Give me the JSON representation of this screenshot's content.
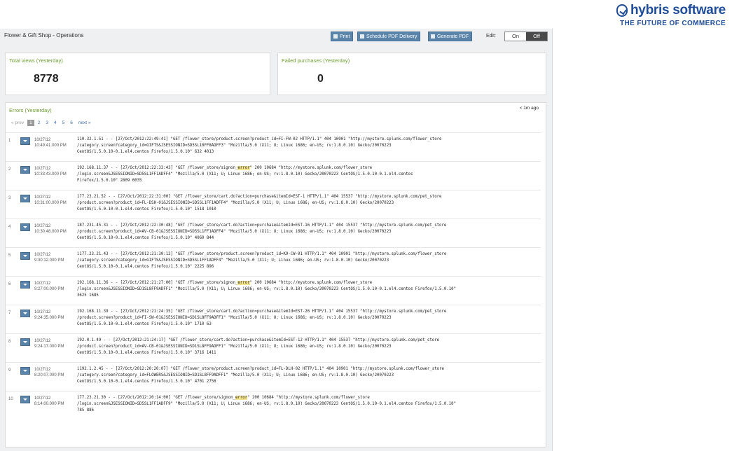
{
  "logo": {
    "brand": "hybris software",
    "tagline": "THE FUTURE OF COMMERCE"
  },
  "app": {
    "title": "Flower & Gift Shop - Operations"
  },
  "toolbar": {
    "print_label": "Print",
    "schedule_label": "Schedule PDF Delivery",
    "generate_label": "Generate PDF",
    "edit_label": "Edit:",
    "on_label": "On",
    "off_label": "Off"
  },
  "panels": {
    "views": {
      "title": "Total views (Yesterday)",
      "value": "8778"
    },
    "failed": {
      "title": "Failed purchases (Yesterday)",
      "value": "0"
    }
  },
  "errors": {
    "title": "Errors (Yesterday)",
    "ago": "< 1m ago",
    "pager": {
      "prev": "« prev",
      "pages": [
        "1",
        "2",
        "3",
        "4",
        "5",
        "6"
      ],
      "next": "next »",
      "current": "1"
    },
    "rows": [
      {
        "idx": "1",
        "date": "10/27/12",
        "time": "10:49:41.000 PM",
        "lines": [
          "110.32.1.51 - - [27/Oct/2012:22:49:41] \"GET /flower_store/product.screen?product_id=FI-FW-02 HTTP/1.1\" 404 10901 \"http://mystore.splunk.com/flower_store",
          "/category.screen?category_id=GIFTS&JSESSIONID=SD5SL10FF8ADFF3\" \"Mozilla/5.0 (X11; U; Linux i686; en-US; rv:1.8.0.10) Gecko/20070223",
          "CentOS/1.5.0.10-0.1.el4.centos Firefox/1.5.0.10\" 632 4013"
        ]
      },
      {
        "idx": "2",
        "date": "10/27/12",
        "time": "10:33:43.000 PM",
        "lines": [
          "192.168.11.37 - - [27/Oct/2012:22:33:43] \"GET /flower_store/signon_",
          "error",
          "\" 200 10684 \"http://mystore.splunk.com/flower_store",
          "/login.screen&JSESSIONID=SD5SL1FF1ADFF4\" \"Mozilla/5.0 (X11; U; Linux i686; en-US; rv:1.8.0.10) Gecko/20070223 CentOS/1.5.0.10-0.1.el4.centos",
          "Firefox/1.5.0.10\" 2809 6035"
        ]
      },
      {
        "idx": "3",
        "date": "10/27/12",
        "time": "10:31:00.000 PM",
        "lines": [
          "177.23.21.52 - - [27/Oct/2012:22:31:00] \"GET /flower_store/cart.do?action=purchase&itemId=EST-1 HTTP/1.1\" 404 15537 \"http://mystore.splunk.com/pet_store",
          "/product.screen?product_id=FL-DSH-01&JSESSIONID=SD5SL1FF1ADFF4\" \"Mozilla/5.0 (X11; U; Linux i686; en-US; rv:1.8.0.10) Gecko/20070223",
          "CentOS/1.5.0.10-0.1.el4.centos Firefox/1.5.0.10\" 1518 1010"
        ]
      },
      {
        "idx": "4",
        "date": "10/27/12",
        "time": "10:30:48.000 PM",
        "lines": [
          "187.231.45.31 - - [27/Oct/2012:22:30:48] \"GET /flower_store/cart.do?action=purchase&itemId=EST-16 HTTP/1.1\" 404 15537 \"http://mystore.splunk.com/pet_store",
          "/product.screen?product_id=AV-CB-01&JSESSIONID=SD5SL1FF1ADFF4\" \"Mozilla/5.0 (X11; U; Linux i686; en-US; rv:1.8.0.10) Gecko/20070223",
          "CentOS/1.5.0.10-0.1.el4.centos Firefox/1.5.0.10\" 4060 844"
        ]
      },
      {
        "idx": "5",
        "date": "10/27/12",
        "time": "9:30:12.000 PM",
        "lines": [
          "i177.23.21.43 - - [27/Oct/2012:21:30:12] \"GET /flower_store/product.screen?product_id=K9-CW-01 HTTP/1.1\" 404 10901 \"http://mystore.splunk.com/flower_store",
          "/category.screen?category_id=GIFTS&JSESSIONID=SD5SL1FF1ADFF4\" \"Mozilla/5.0 (X11; U; Linux i686; en-US; rv:1.8.0.10) Gecko/20070223",
          "CentOS/1.5.0.10-0.1.el4.centos Firefox/1.5.0.10\" 2225 896"
        ]
      },
      {
        "idx": "6",
        "date": "10/27/12",
        "time": "9:27:00.000 PM",
        "lines": [
          "192.168.11.36 - - [27/Oct/2012:21:27:00] \"GET /flower_store/signon_",
          "error",
          "\" 200 10684 \"http://mystore.splunk.com/flower_store",
          "/login.screen&JSESSIONID=SD1SL8FF9ADFF1\" \"Mozilla/5.0 (X11; U; Linux i686; en-US; rv:1.8.0.10) Gecko/20070223 CentOS/1.5.0.10-0.1.el4.centos Firefox/1.5.0.10\"",
          "3625 1685"
        ]
      },
      {
        "idx": "7",
        "date": "10/27/12",
        "time": "9:24:35.000 PM",
        "lines": [
          "192.168.11.39 - - [27/Oct/2012:21:24:35] \"GET /flower_store/cart.do?action=purchase&itemId=EST-26 HTTP/1.1\" 404 15537 \"http://mystore.splunk.com/pet_store",
          "/product.screen?product_id=FI-SW-01&JSESSIONID=SD1SL8FF9ADFF1\" \"Mozilla/5.0 (X11; U; Linux i686; en-US; rv:1.8.0.10) Gecko/20070223",
          "CentOS/1.5.0.10-0.1.el4.centos Firefox/1.5.0.10\" 1710 63"
        ]
      },
      {
        "idx": "8",
        "date": "10/27/12",
        "time": "9:24:17.000 PM",
        "lines": [
          "192.0.1.49 - - [27/Oct/2012:21:24:17] \"GET /flower_store/cart.do?action=purchase&itemId=EST-12 HTTP/1.1\" 404 15537 \"http://mystore.splunk.com/pet_store",
          "/product.screen?product_id=AV-CB-01&JSESSIONID=SD1SL8FF9ADFF1\" \"Mozilla/5.0 (X11; U; Linux i686; en-US; rv:1.8.0.10) Gecko/20070223",
          "CentOS/1.5.0.10-0.1.el4.centos Firefox/1.5.0.10\" 3716 1411"
        ]
      },
      {
        "idx": "9",
        "date": "10/27/12",
        "time": "8:20:07.000 PM",
        "lines": [
          "i192.1.2.45 - - [27/Oct/2012:20:20:07] \"GET /flower_store/product.screen?product_id=FL-DLH-02 HTTP/1.1\" 404 10901 \"http://mystore.splunk.com/flower_store",
          "/category.screen?category_id=FLOWERS&JSESSIONID=SD1SL8FF9ADFF1\" \"Mozilla/5.0 (X11; U; Linux i686; en-US; rv:1.8.0.10) Gecko/20070223",
          "CentOS/1.5.0.10-0.1.el4.centos Firefox/1.5.0.10\" 4701 2756"
        ]
      },
      {
        "idx": "10",
        "date": "10/27/12",
        "time": "8:14:00.000 PM",
        "lines": [
          "177.23.21.30 - - [27/Oct/2012:20:14:00] \"GET /flower_store/signon_",
          "error",
          "\" 200 10684 \"http://mystore.splunk.com/flower_store",
          "/login.screen&JSESSIONID=SD5SL1FF1ADFF9\" \"Mozilla/5.0 (X11; U; Linux i686; en-US; rv:1.8.0.10) Gecko/20070223 CentOS/1.5.0.10-0.1.el4.centos Firefox/1.5.0.10\"",
          "785 886"
        ]
      }
    ]
  }
}
